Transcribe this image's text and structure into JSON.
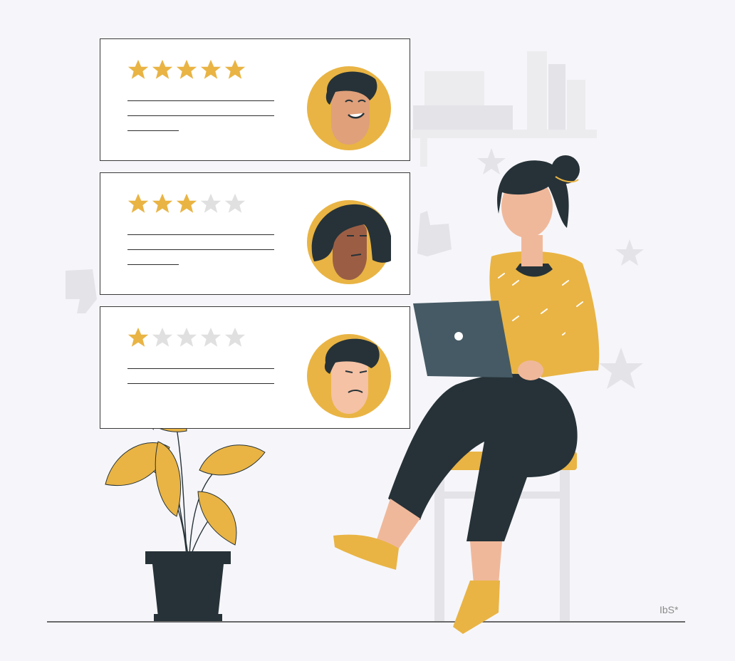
{
  "illustration": {
    "watermark": "IbS*",
    "colors": {
      "background": "#f6f6fa",
      "accent": "#e9b444",
      "dark": "#263238",
      "star_empty": "#e0e0e0",
      "card": "#ffffff"
    }
  },
  "reviews": [
    {
      "rating": 5,
      "max": 5,
      "reviewer": "smiling-man"
    },
    {
      "rating": 3,
      "max": 5,
      "reviewer": "neutral-woman"
    },
    {
      "rating": 1,
      "max": 5,
      "reviewer": "unhappy-man"
    }
  ]
}
